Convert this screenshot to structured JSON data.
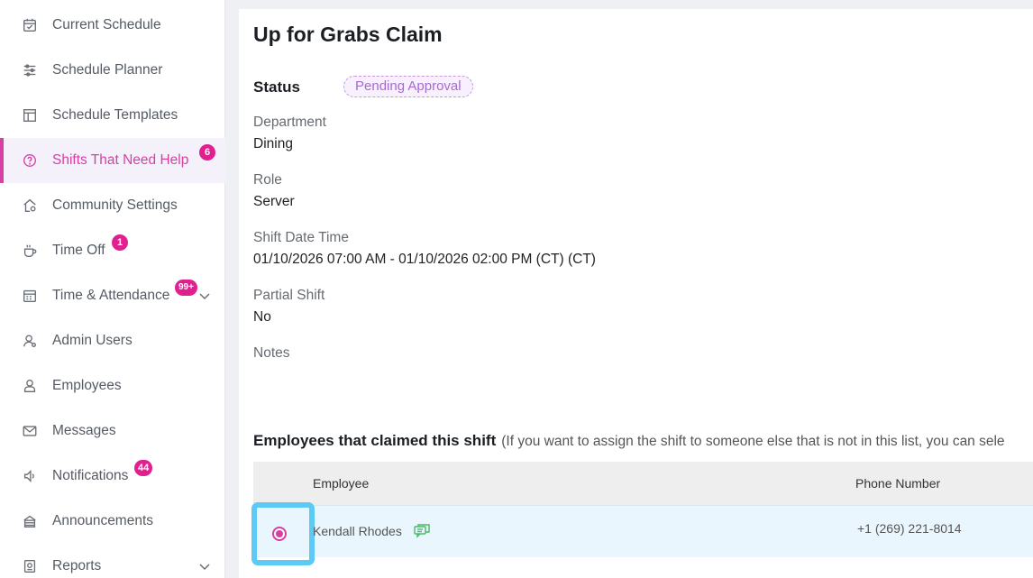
{
  "sidebar": {
    "items": [
      {
        "label": "Current Schedule",
        "icon": "calendar-check-icon"
      },
      {
        "label": "Schedule Planner",
        "icon": "sliders-icon"
      },
      {
        "label": "Schedule Templates",
        "icon": "template-icon"
      },
      {
        "label": "Shifts That Need Help",
        "icon": "help-circle-icon",
        "badge": "6",
        "active": true
      },
      {
        "label": "Community Settings",
        "icon": "home-gear-icon"
      },
      {
        "label": "Time Off",
        "icon": "coffee-icon",
        "badge": "1"
      },
      {
        "label": "Time & Attendance",
        "icon": "calendar-grid-icon",
        "badge": "99+",
        "expandable": true
      },
      {
        "label": "Admin Users",
        "icon": "admin-user-icon"
      },
      {
        "label": "Employees",
        "icon": "employee-icon"
      },
      {
        "label": "Messages",
        "icon": "mail-icon"
      },
      {
        "label": "Notifications",
        "icon": "speaker-icon",
        "badge": "44"
      },
      {
        "label": "Announcements",
        "icon": "megaphone-icon"
      },
      {
        "label": "Reports",
        "icon": "report-icon",
        "expandable": true
      }
    ]
  },
  "main": {
    "title": "Up for Grabs Claim",
    "status_label": "Status",
    "status_value": "Pending Approval",
    "fields": [
      {
        "label": "Department",
        "value": "Dining"
      },
      {
        "label": "Role",
        "value": "Server"
      },
      {
        "label": "Shift Date Time",
        "value": "01/10/2026 07:00 AM - 01/10/2026 02:00 PM (CT) (CT)"
      },
      {
        "label": "Partial Shift",
        "value": "No"
      },
      {
        "label": "Notes",
        "value": ""
      }
    ],
    "claims_title": "Employees that claimed this shift",
    "claims_hint": "(If you want to assign the shift to someone else that is not in this list, you can sele",
    "table": {
      "headers": {
        "employee": "Employee",
        "phone": "Phone Number"
      },
      "rows": [
        {
          "employee": "Kendall Rhodes",
          "phone": "+1 (269) 221-8014",
          "selected": true
        }
      ]
    }
  },
  "colors": {
    "accent": "#d63fa4",
    "badge": "#e0208f",
    "highlight": "#5ccaf4",
    "status_text": "#a66ad4",
    "chat_icon": "#4cb86a"
  }
}
